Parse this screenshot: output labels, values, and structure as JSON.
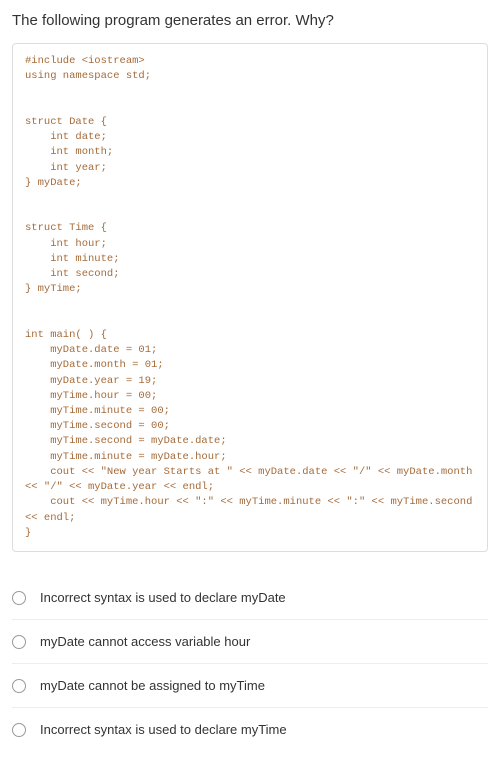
{
  "question": "The following program generates an error. Why?",
  "code": "#include <iostream>\nusing namespace std;\n\n\nstruct Date {\n    int date;\n    int month;\n    int year;\n} myDate;\n\n\nstruct Time {\n    int hour;\n    int minute;\n    int second;\n} myTime;\n\n\nint main( ) {\n    myDate.date = 01;\n    myDate.month = 01;\n    myDate.year = 19;\n    myTime.hour = 00;\n    myTime.minute = 00;\n    myTime.second = 00;\n    myTime.second = myDate.date;\n    myTime.minute = myDate.hour;\n    cout << \"New year Starts at \" << myDate.date << \"/\" << myDate.month\n<< \"/\" << myDate.year << endl;\n    cout << myTime.hour << \":\" << myTime.minute << \":\" << myTime.second\n<< endl;\n}",
  "options": [
    {
      "label": "Incorrect syntax is used to declare myDate"
    },
    {
      "label": "myDate cannot access variable hour"
    },
    {
      "label": "myDate cannot be assigned to myTime"
    },
    {
      "label": "Incorrect syntax is used to declare myTime"
    }
  ]
}
